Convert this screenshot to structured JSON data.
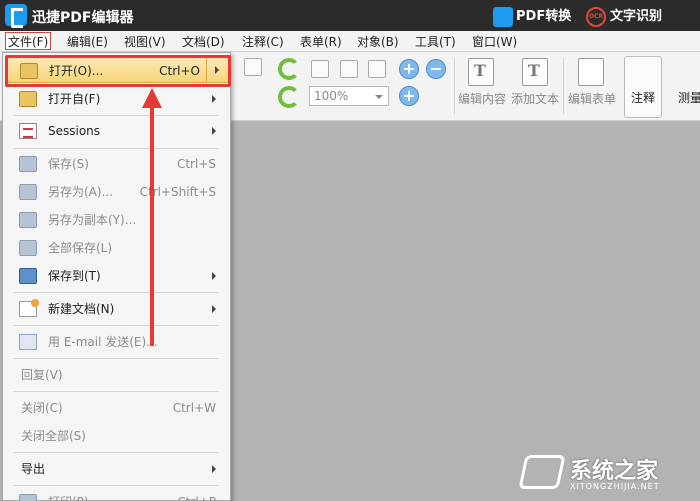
{
  "titlebar": {
    "app_title": "迅捷PDF编辑器",
    "pdf_convert": "PDF转换",
    "ocr_icon_text": "OCR",
    "ocr_label": "文字识别"
  },
  "menubar": {
    "items": [
      {
        "label": "文件(F)",
        "active": true
      },
      {
        "label": "编辑(E)"
      },
      {
        "label": "视图(V)"
      },
      {
        "label": "文档(D)"
      },
      {
        "label": "注释(C)"
      },
      {
        "label": "表单(R)"
      },
      {
        "label": "对象(B)"
      },
      {
        "label": "工具(T)"
      },
      {
        "label": "窗口(W)"
      }
    ]
  },
  "toolbar": {
    "zoom_value": "100%",
    "edit_content": "编辑内容",
    "add_text": "添加文本",
    "edit_form": "编辑表单",
    "annotate": "注释",
    "measure": "测量",
    "icons": [
      "select-text-icon",
      "rotate-cw-icon",
      "rotate-ccw-icon",
      "page-1-icon",
      "fit-page-icon",
      "fit-width-icon",
      "zoom-in-icon",
      "zoom-out-icon",
      "zoom-plus-icon"
    ]
  },
  "file_menu": {
    "items": [
      {
        "label": "打开(O)...",
        "shortcut": "Ctrl+O",
        "submenu": true,
        "highlight": true,
        "icon": "folder-icon"
      },
      {
        "label": "打开自(F)",
        "submenu": true,
        "icon": "folder-open-from-icon"
      },
      {
        "label": "Sessions",
        "submenu": true,
        "icon": "sessions-icon"
      },
      {
        "label": "保存(S)",
        "shortcut": "Ctrl+S",
        "disabled": true,
        "icon": "save-icon"
      },
      {
        "label": "另存为(A)...",
        "shortcut": "Ctrl+Shift+S",
        "disabled": true,
        "icon": "save-as-icon"
      },
      {
        "label": "另存为副本(Y)...",
        "disabled": true,
        "icon": "save-copy-icon"
      },
      {
        "label": "全部保存(L)",
        "disabled": true,
        "icon": "save-all-icon"
      },
      {
        "label": "保存到(T)",
        "submenu": true,
        "icon": "save-to-icon"
      },
      {
        "label": "新建文档(N)",
        "submenu": true,
        "icon": "new-document-icon"
      },
      {
        "label": "用 E-mail 发送(E)...",
        "disabled": true,
        "icon": "email-icon"
      },
      {
        "label": "回复(V)",
        "disabled": true
      },
      {
        "label": "关闭(C)",
        "shortcut": "Ctrl+W",
        "disabled": true
      },
      {
        "label": "关闭全部(S)",
        "disabled": true
      },
      {
        "label": "导出",
        "submenu": true
      },
      {
        "label": "打印(P)...",
        "shortcut": "Ctrl+P",
        "disabled": true,
        "icon": "print-icon"
      }
    ]
  },
  "watermark": {
    "text": "系统之家",
    "url": "XITONGZHIJIA.NET"
  },
  "colors": {
    "highlight_frame": "#e23a34",
    "arrow": "#e23a34",
    "titlebar_bg": "#2b2b2b",
    "canvas_bg": "#b3b3b3"
  }
}
